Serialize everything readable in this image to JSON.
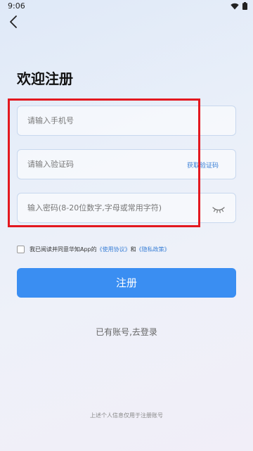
{
  "status_bar": {
    "time": "9:06"
  },
  "page": {
    "title": "欢迎注册"
  },
  "form": {
    "phone_placeholder": "请输入手机号",
    "code_placeholder": "请输入验证码",
    "get_code_label": "获取验证码",
    "password_placeholder": "输入密码(8-20位数字,字母或常用字符)"
  },
  "agreement": {
    "prefix": "我已阅读并同意华知App的",
    "terms": "《使用协议》",
    "conjunction": "和",
    "privacy": "《隐私政策》"
  },
  "register_button": "注册",
  "login_link": "已有账号,去登录",
  "footer_note": "上述个人信息仅用于注册账号",
  "colors": {
    "accent": "#3a8ef2",
    "link": "#3a7fd6",
    "highlight": "#e3181f"
  },
  "icons": [
    "back-arrow-icon",
    "wifi-icon",
    "battery-icon",
    "eye-closed-icon"
  ]
}
